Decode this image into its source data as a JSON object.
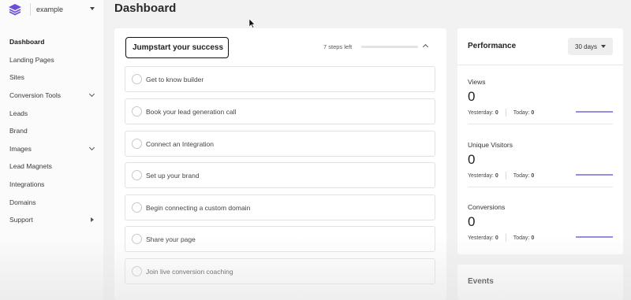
{
  "workspace": {
    "name": "example",
    "logo_icon": "layers-logo-icon",
    "accent": "#6c4fd8"
  },
  "header": {
    "title": "Dashboard"
  },
  "sidebar": {
    "items": [
      {
        "label": "Dashboard",
        "active": true
      },
      {
        "label": "Landing Pages"
      },
      {
        "label": "Sites"
      },
      {
        "label": "Conversion Tools",
        "icon": "chevron-down-icon"
      },
      {
        "label": "Leads"
      },
      {
        "label": "Brand"
      },
      {
        "label": "Images",
        "icon": "chevron-down-icon"
      },
      {
        "label": "Lead Magnets"
      },
      {
        "label": "Integrations"
      },
      {
        "label": "Domains"
      },
      {
        "label": "Support",
        "icon": "caret-right-icon"
      }
    ]
  },
  "jumpstart": {
    "title": "Jumpstart your success",
    "steps_left": "7 steps left",
    "progress_fraction": 0,
    "steps": [
      {
        "label": "Get to know builder"
      },
      {
        "label": "Book your lead generation call"
      },
      {
        "label": "Connect an Integration"
      },
      {
        "label": "Set up your brand"
      },
      {
        "label": "Begin connecting a custom domain"
      },
      {
        "label": "Share your page"
      },
      {
        "label": "Join live conversion coaching"
      }
    ]
  },
  "performance": {
    "title": "Performance",
    "range": "30 days",
    "metrics": [
      {
        "label": "Views",
        "value": "0",
        "yesterday_label": "Yesterday:",
        "yesterday": "0",
        "today_label": "Today:",
        "today": "0"
      },
      {
        "label": "Unique Visitors",
        "value": "0",
        "yesterday_label": "Yesterday:",
        "yesterday": "0",
        "today_label": "Today:",
        "today": "0"
      },
      {
        "label": "Conversions",
        "value": "0",
        "yesterday_label": "Yesterday:",
        "yesterday": "0",
        "today_label": "Today:",
        "today": "0"
      }
    ],
    "sparkline_color": "#9a8ae0"
  },
  "events": {
    "title": "Events"
  }
}
